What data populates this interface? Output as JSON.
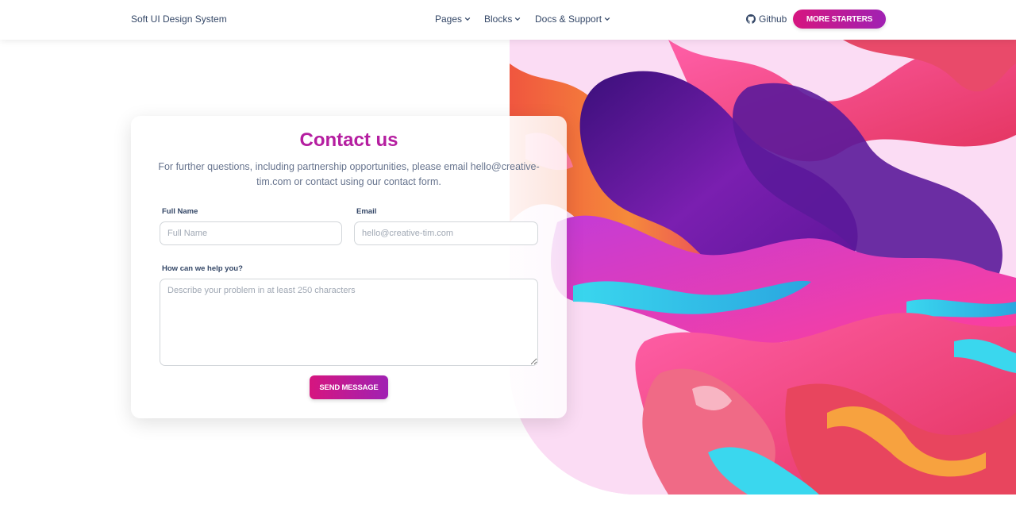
{
  "navbar": {
    "brand": "Soft UI Design System",
    "items": [
      {
        "label": "Pages"
      },
      {
        "label": "Blocks"
      },
      {
        "label": "Docs & Support"
      }
    ],
    "github_label": "Github",
    "cta_label": "MORE STARTERS"
  },
  "contact": {
    "title": "Contact us",
    "subtitle": "For further questions, including partnership opportunities, please email hello@creative-tim.com or contact using our contact form.",
    "full_name": {
      "label": "Full Name",
      "placeholder": "Full Name",
      "value": ""
    },
    "email": {
      "label": "Email",
      "placeholder": "hello@creative-tim.com",
      "value": ""
    },
    "message": {
      "label": "How can we help you?",
      "placeholder": "Describe your problem in at least 250 characters",
      "value": ""
    },
    "submit_label": "SEND MESSAGE"
  },
  "colors": {
    "accent_start": "#d6157f",
    "accent_end": "#a021b3",
    "title_color": "#b51ea0",
    "text_dark": "#344767",
    "text_muted": "#67748e",
    "art_background": "#fbdcf4"
  },
  "icons": {
    "dropdown": "chevron-down-icon",
    "github": "github-icon"
  }
}
